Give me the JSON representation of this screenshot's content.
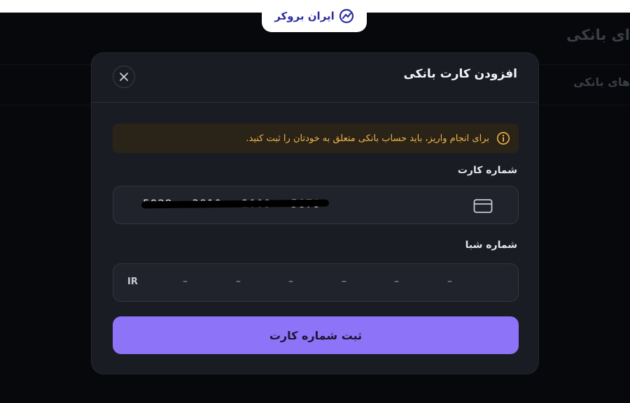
{
  "brand": {
    "logo_text": "ایران بروکر"
  },
  "background": {
    "title": "ای بانکی",
    "subtitle": "های بانکی"
  },
  "modal": {
    "title": "افزودن کارت بانکی",
    "close_icon": "close-icon",
    "alert": {
      "icon": "info-icon",
      "text": "برای انجام واریز، باید حساب بانکی متعلق به خودتان را ثبت کنید.",
      "color": "#f0b548"
    },
    "card_field": {
      "label": "شماره کارت",
      "groups": [
        "5029",
        "3810",
        "2009",
        "5879"
      ],
      "icon": "credit-card-icon"
    },
    "iban_field": {
      "label": "شماره شبا",
      "prefix": "IR",
      "separators": [
        "–",
        "–",
        "–",
        "–",
        "–",
        "–"
      ]
    },
    "submit_label": "ثبت شماره کارت"
  },
  "colors": {
    "accent": "#8d73f7",
    "background": "#07080b",
    "modal": "#1a1c24",
    "warning": "#f0b548"
  }
}
